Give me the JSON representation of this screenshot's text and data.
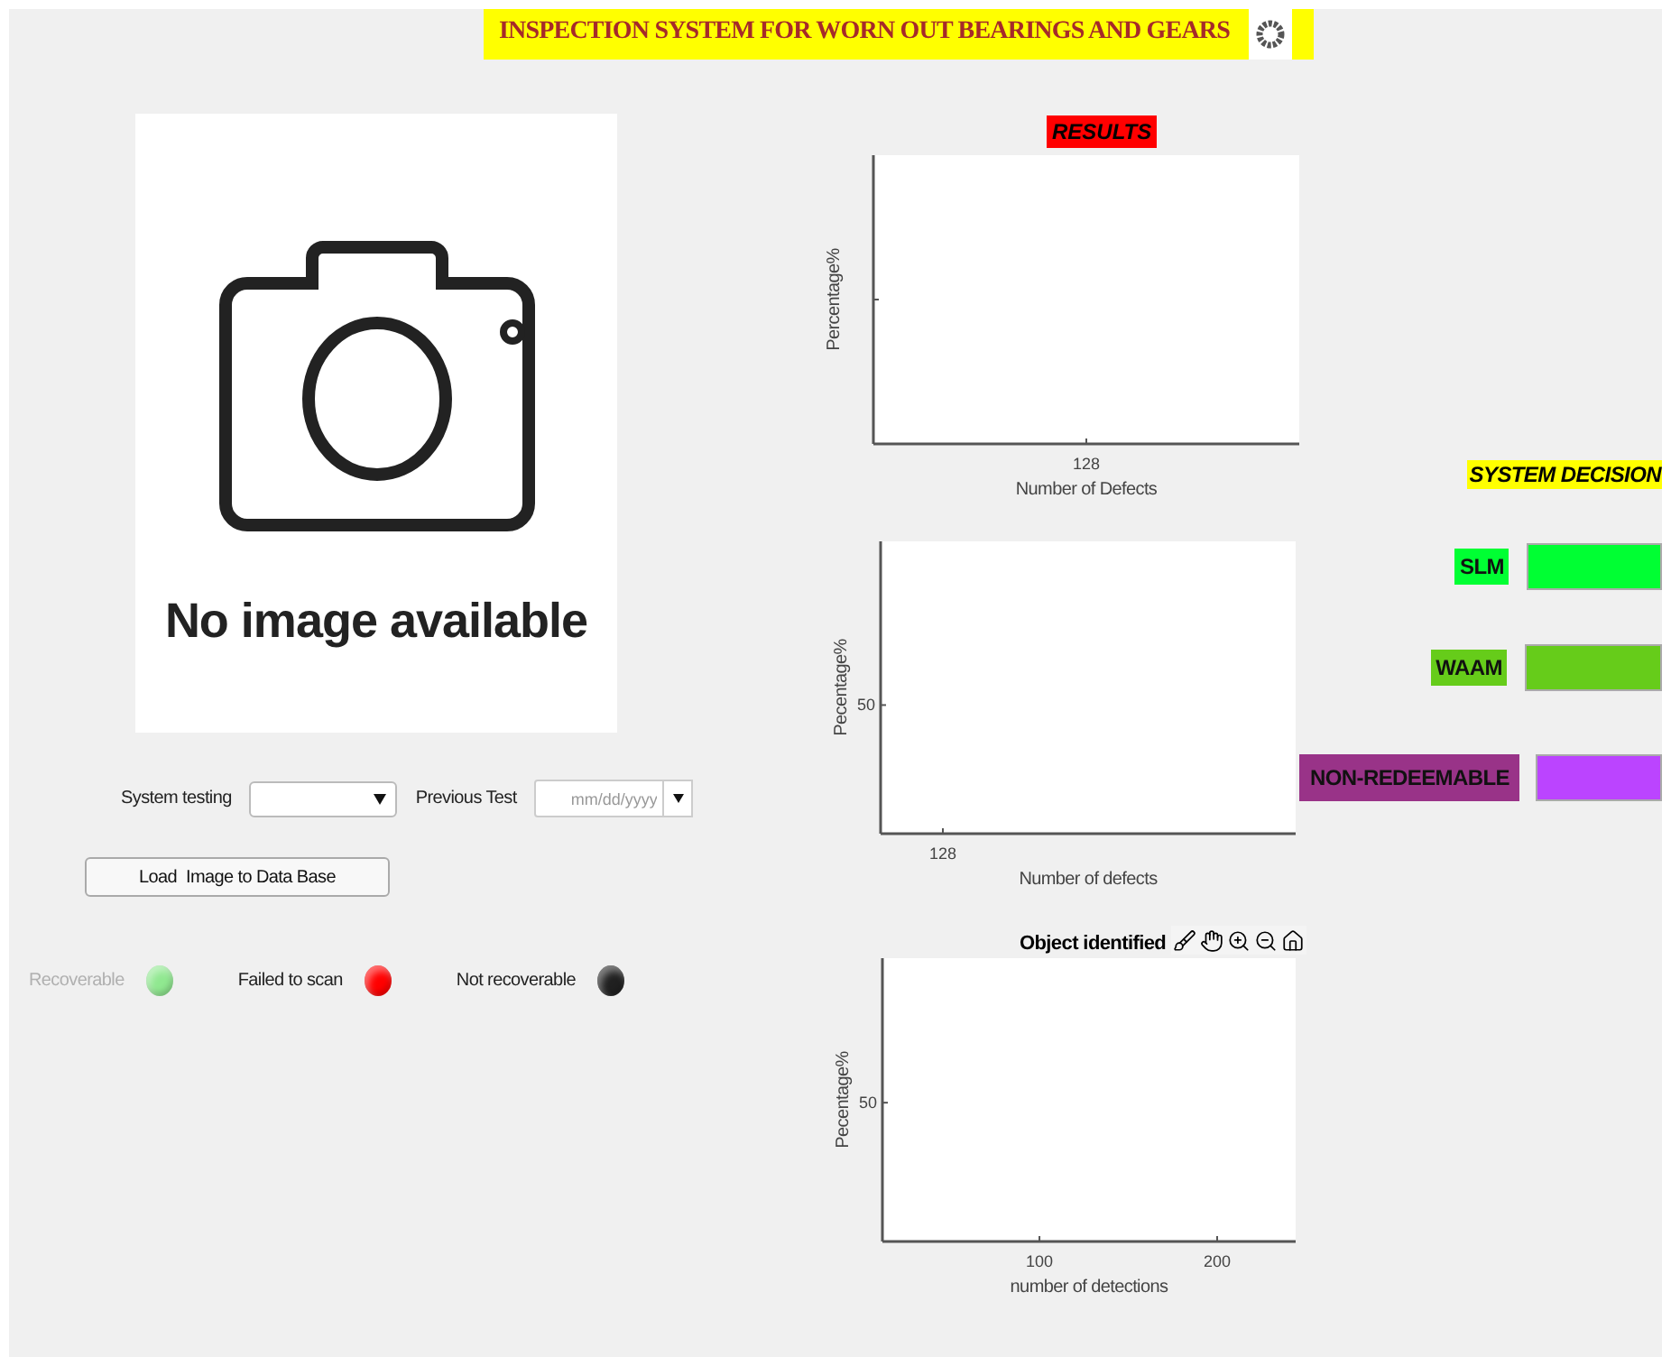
{
  "header": {
    "title": "INSPECTION SYSTEM FOR WORN OUT BEARINGS AND GEARS"
  },
  "image_panel": {
    "text": "No image available"
  },
  "controls": {
    "system_testing": {
      "label": "System testing"
    },
    "previous_test": {
      "label": "Previous Test",
      "placeholder": "mm/dd/yyyy"
    },
    "load_button": "Load  Image to Data Base"
  },
  "status_lamps": [
    {
      "label": "Recoverable",
      "color": "#90e890",
      "disabled": true
    },
    {
      "label": "Failed to scan",
      "color": "#ff0000",
      "disabled": false
    },
    {
      "label": "Not recoverable",
      "color": "#202020",
      "disabled": false
    }
  ],
  "results_label": "RESULTS",
  "charts": [
    {
      "x_axis_title": "Number of Defects",
      "y_axis_title": "Percentage%",
      "x_tick_labels": [
        "128"
      ]
    },
    {
      "x_axis_title": "Number of defects",
      "y_axis_title": "Pecentage%",
      "x_tick_labels": [
        "128"
      ],
      "y_tick_labels": [
        "50"
      ]
    },
    {
      "title": "Object identified",
      "x_axis_title": "number of detections",
      "y_axis_title": "Pecentage%",
      "x_tick_labels": [
        "100",
        "200"
      ],
      "y_tick_labels": [
        "50"
      ]
    }
  ],
  "system_decision": {
    "title": "SYSTEM DECISION",
    "options": [
      {
        "label": {
          "text": "SLM",
          "color": "#00ff33"
        },
        "indicator": {
          "color": "#00ff33"
        }
      },
      {
        "label": {
          "text": "WAAM",
          "color": "#66cc1a"
        },
        "indicator": {
          "color": "#66cc1a"
        }
      },
      {
        "label": {
          "text": "NON-REDEEMABLE",
          "color": "#993388"
        },
        "indicator": {
          "color": "#bb44ff"
        }
      }
    ]
  }
}
